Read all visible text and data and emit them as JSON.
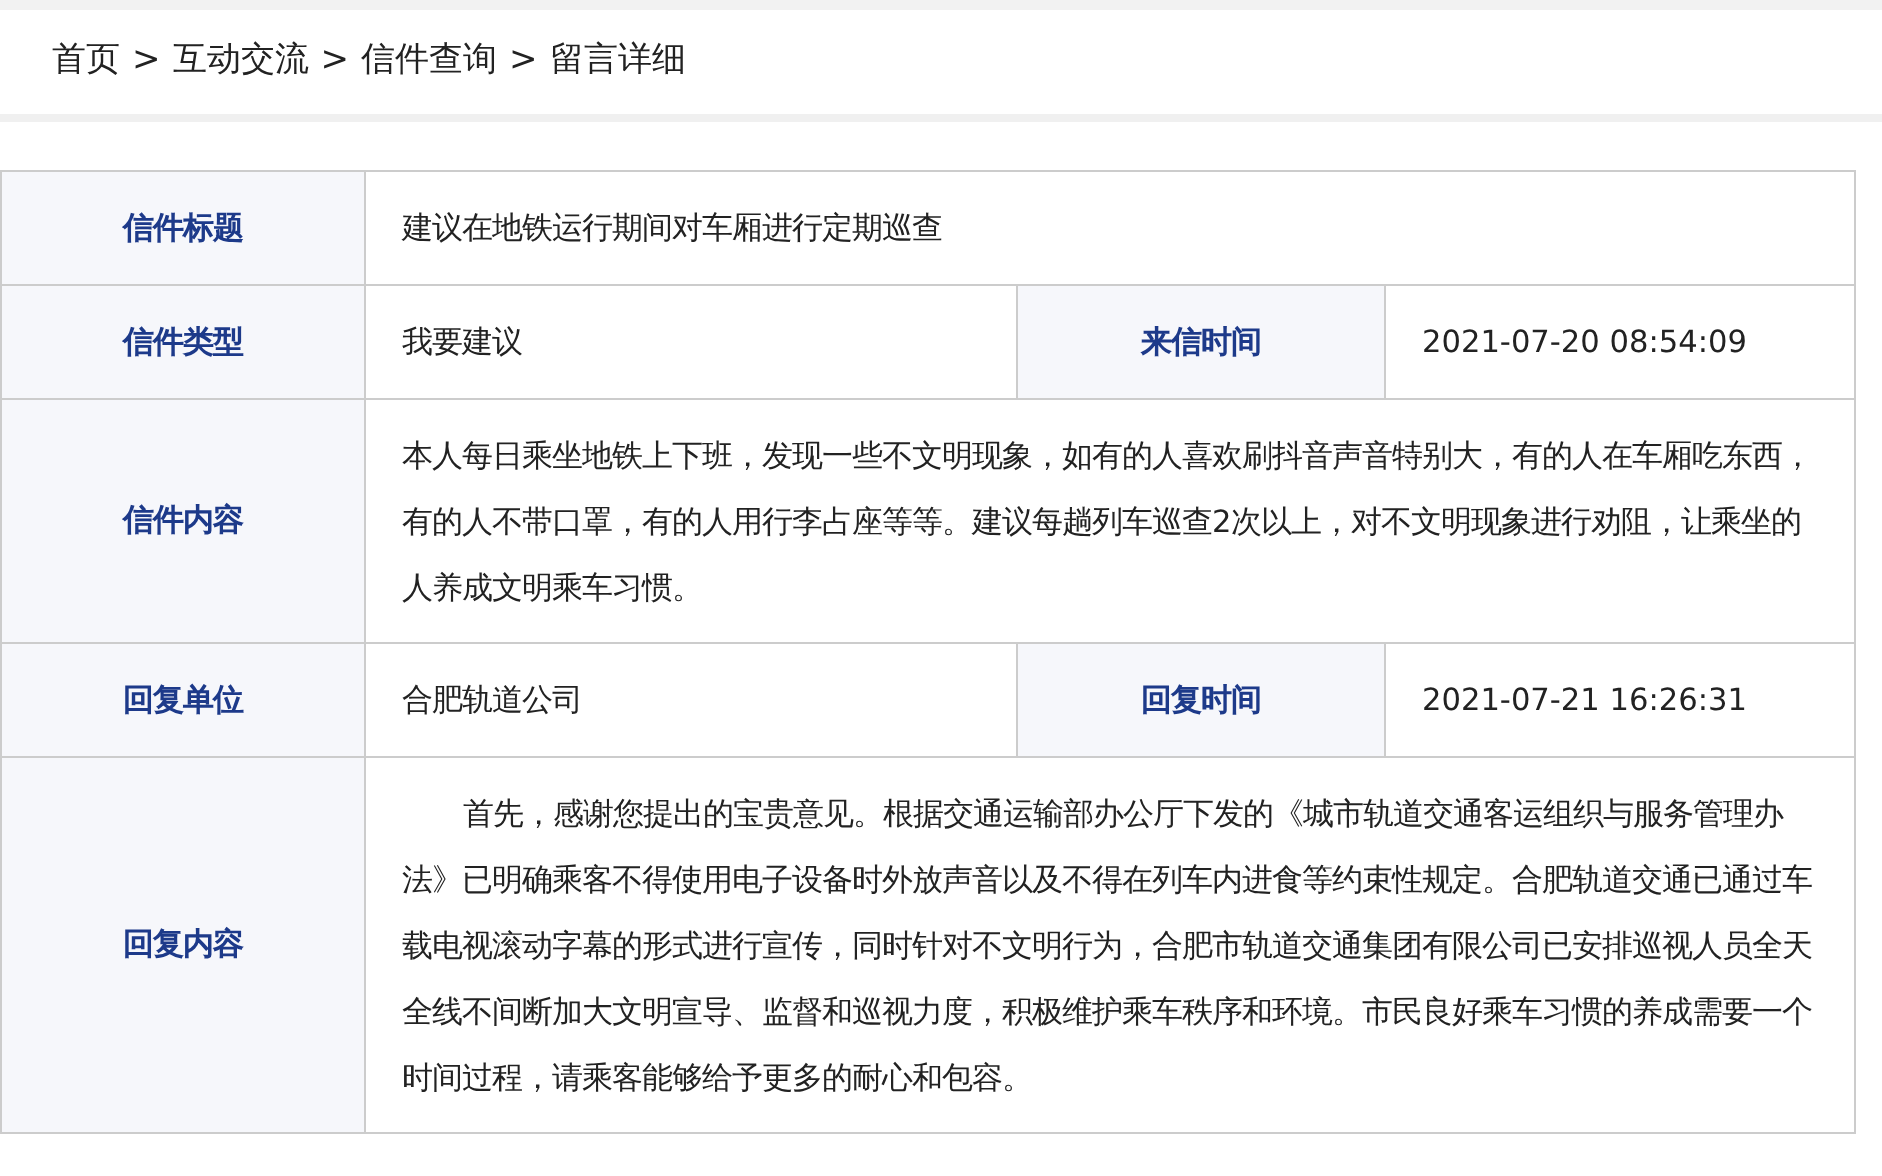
{
  "breadcrumb": [
    "首页",
    ">",
    "互动交流",
    ">",
    "信件查询",
    ">",
    "留言详细"
  ],
  "rows": [
    {
      "cells": [
        {
          "label": "信件标题",
          "value": "建议在地铁运行期间对车厢进行定期巡查"
        }
      ]
    },
    {
      "cells": [
        {
          "label": "信件类型",
          "value": "我要建议"
        },
        {
          "label": "来信时间",
          "value": "2021-07-20 08:54:09"
        }
      ]
    },
    {
      "cells": [
        {
          "label": "信件内容",
          "value": "本人每日乘坐地铁上下班，发现一些不文明现象，如有的人喜欢刷抖音声音特别大，有的人在车厢吃东西，有的人不带口罩，有的人用行李占座等等。建议每趟列车巡查2次以上，对不文明现象进行劝阻，让乘坐的人养成文明乘车习惯。"
        }
      ]
    },
    {
      "cells": [
        {
          "label": "回复单位",
          "value": "合肥轨道公司"
        },
        {
          "label": "回复时间",
          "value": "2021-07-21 16:26:31"
        }
      ]
    },
    {
      "cells": [
        {
          "label": "回复内容",
          "value": "首先，感谢您提出的宝贵意见。根据交通运输部办公厅下发的《城市轨道交通客运组织与服务管理办法》已明确乘客不得使用电子设备时外放声音以及不得在列车内进食等约束性规定。合肥轨道交通已通过车载电视滚动字幕的形式进行宣传，同时针对不文明行为，合肥市轨道交通集团有限公司已安排巡视人员全天全线不间断加大文明宣导、监督和巡视力度，积极维护乘车秩序和环境。市民良好乘车习惯的养成需要一个时间过程，请乘客能够给予更多的耐心和包容。",
          "indent": true
        }
      ]
    }
  ]
}
